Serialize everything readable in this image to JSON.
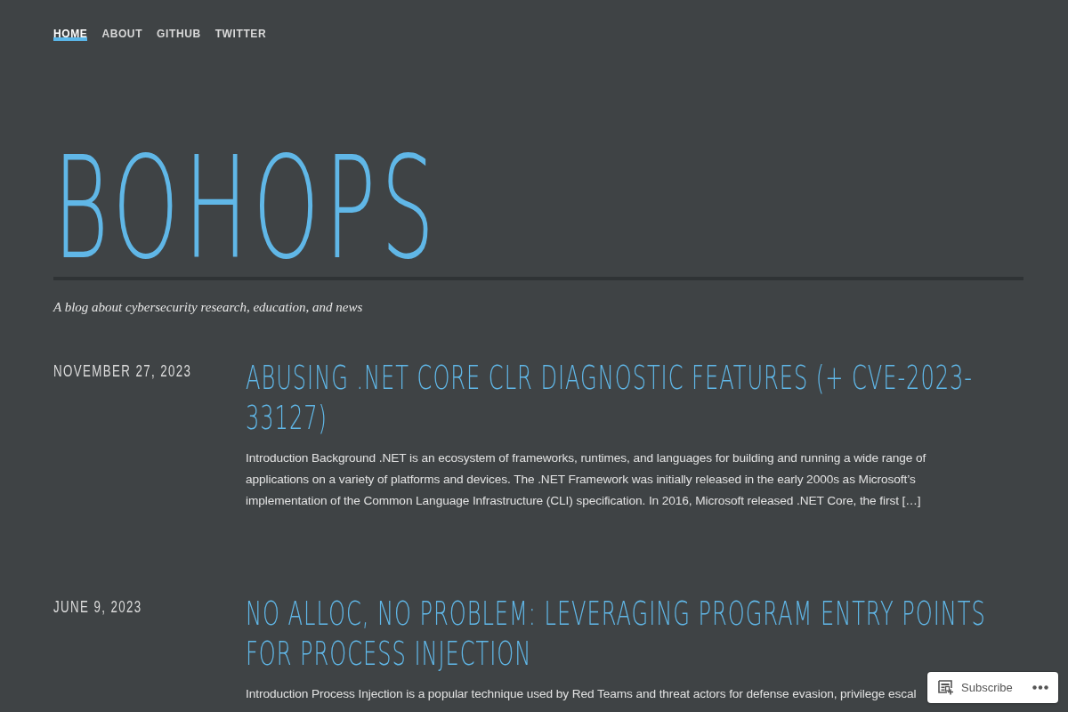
{
  "nav": {
    "items": [
      {
        "label": "HOME",
        "selected": true
      },
      {
        "label": "ABOUT",
        "selected": false
      },
      {
        "label": "GITHUB",
        "selected": false
      },
      {
        "label": "TWITTER",
        "selected": false
      }
    ]
  },
  "site": {
    "title": "BOHOPS",
    "tagline": "A blog about cybersecurity research, education, and news"
  },
  "posts": [
    {
      "date": "NOVEMBER 27, 2023",
      "title": "ABUSING .NET CORE CLR DIAGNOSTIC FEATURES (+ CVE-2023-33127)",
      "excerpt": "Introduction Background .NET is an ecosystem of frameworks, runtimes, and languages for building and running a wide range of applications on a variety of platforms and devices. The .NET Framework was initially released in the early 2000s as Microsoft’s implementation of the Common Language Infrastructure (CLI) specification. In 2016, Microsoft released .NET Core, the first […]"
    },
    {
      "date": "JUNE 9, 2023",
      "title": "NO ALLOC, NO PROBLEM: LEVERAGING PROGRAM ENTRY POINTS FOR PROCESS INJECTION",
      "excerpt": "Introduction Process Injection is a popular technique used by Red Teams and threat actors for defense evasion, privilege escal"
    }
  ],
  "subscribe_bar": {
    "label": "Subscribe"
  }
}
